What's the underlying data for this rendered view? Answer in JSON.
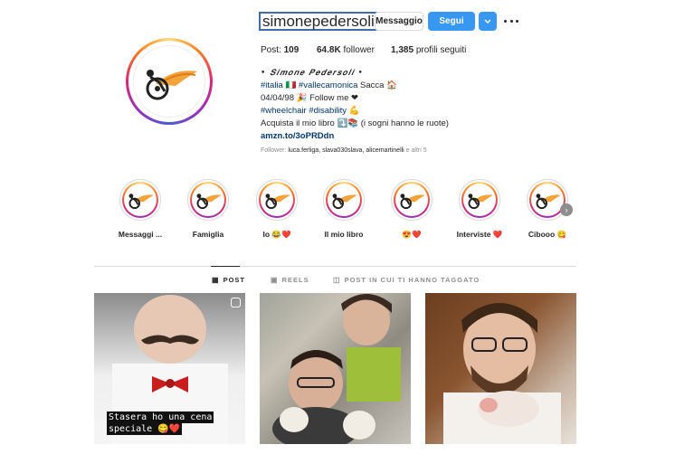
{
  "profile": {
    "username": "simonepedersoli",
    "message_button": "Messaggio",
    "follow_button": "Segui",
    "stats": {
      "posts_label": "Post:",
      "posts_value": "109",
      "followers_value": "64.8K",
      "followers_label": "follower",
      "following_value": "1,385",
      "following_label": "profili seguiti"
    },
    "bio": {
      "name": "• 𝑺𝒊𝒎𝒐𝒏𝒆 𝑷𝒆𝒅𝒆𝒓𝒔𝒐𝒍𝒊 •",
      "line1_tags": "#italia 🇮🇹 #vallecamonica",
      "line1_rest": " Sacca 🏠",
      "line2": "04/04/98 🎉 Follow me ❤",
      "line3_tags": "#wheelchair #disability 💪",
      "line4": "Acquista il mio libro ⤵️📚 (i sogni hanno le ruote)",
      "link": "amzn.to/3oPRDdn"
    },
    "followed_by": {
      "prefix": "Follower: ",
      "names": "luca.ferliga, slava030slava, alicemartinelli",
      "suffix": " e altri 5"
    }
  },
  "highlights": [
    {
      "label": "Messaggi ..."
    },
    {
      "label": "Famiglia"
    },
    {
      "label": "Io 😂❤️"
    },
    {
      "label": "Il mio libro"
    },
    {
      "label": "😍❤️"
    },
    {
      "label": "Interviste ❤️"
    },
    {
      "label": "Cibooo 😋"
    }
  ],
  "tabs": [
    {
      "label": "POST",
      "icon": "grid-icon"
    },
    {
      "label": "REELS",
      "icon": "reels-icon"
    },
    {
      "label": "POST IN CUI TI HANNO TAGGATO",
      "icon": "tagged-icon"
    }
  ],
  "posts": [
    {
      "caption_line1": "Stasera ho una cena",
      "caption_line2": "speciale 😋❤️"
    }
  ],
  "colors": {
    "accent": "#3897f0",
    "link": "#00376b",
    "muted": "#8e8e8e"
  }
}
